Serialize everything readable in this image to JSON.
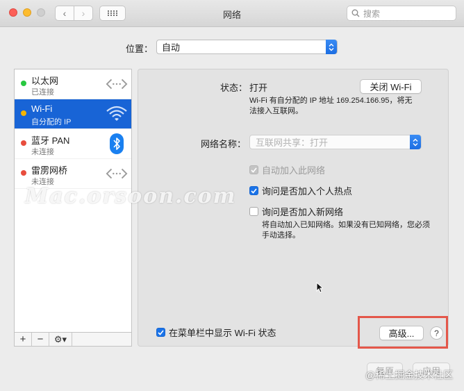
{
  "window": {
    "title": "网络"
  },
  "toolbar": {
    "search_placeholder": "搜索"
  },
  "location": {
    "label": "位置：",
    "value": "自动"
  },
  "services": [
    {
      "name": "以太网",
      "status": "已连接",
      "dot_color": "#28c840",
      "icon": "ethernet-arrows-icon"
    },
    {
      "name": "Wi-Fi",
      "status": "自分配的 IP",
      "dot_color": "#f4b400",
      "icon": "wifi-icon"
    },
    {
      "name": "蓝牙 PAN",
      "status": "未连接",
      "dot_color": "#e84d3d",
      "icon": "bluetooth-icon"
    },
    {
      "name": "雷雳网桥",
      "status": "未连接",
      "dot_color": "#e84d3d",
      "icon": "thunderbolt-bridge-arrows-icon"
    }
  ],
  "sidebar_toolbar": {
    "add": "+",
    "remove": "−",
    "gear": "⚙▾"
  },
  "detail": {
    "status_label": "状态：",
    "status_value": "打开",
    "turn_off_button": "关闭 Wi-Fi",
    "status_desc_line1": "Wi-Fi 有自分配的 IP 地址 169.254.166.95，将无",
    "status_desc_line2": "法接入互联网。",
    "network_name_label": "网络名称：",
    "network_name_placeholder": "互联网共享：打开",
    "auto_join_label": "自动加入此网络",
    "ask_hotspot_label": "询问是否加入个人热点",
    "ask_new_label": "询问是否加入新网络",
    "ask_new_desc_line1": "将自动加入已知网络。如果没有已知网络，您必须",
    "ask_new_desc_line2": "手动选择。",
    "menubar_label": "在菜单栏中显示 Wi-Fi 状态",
    "advanced_button": "高级...",
    "help_button": "?"
  },
  "footer": {
    "revert": "复原",
    "apply": "应用"
  },
  "watermarks": {
    "main": "Mac.orsoon.com",
    "corner": "@稀土掘金技术社区"
  },
  "colors": {
    "accent": "#1a73e8",
    "selection": "#1864d6",
    "highlight_box": "#e4574a"
  }
}
